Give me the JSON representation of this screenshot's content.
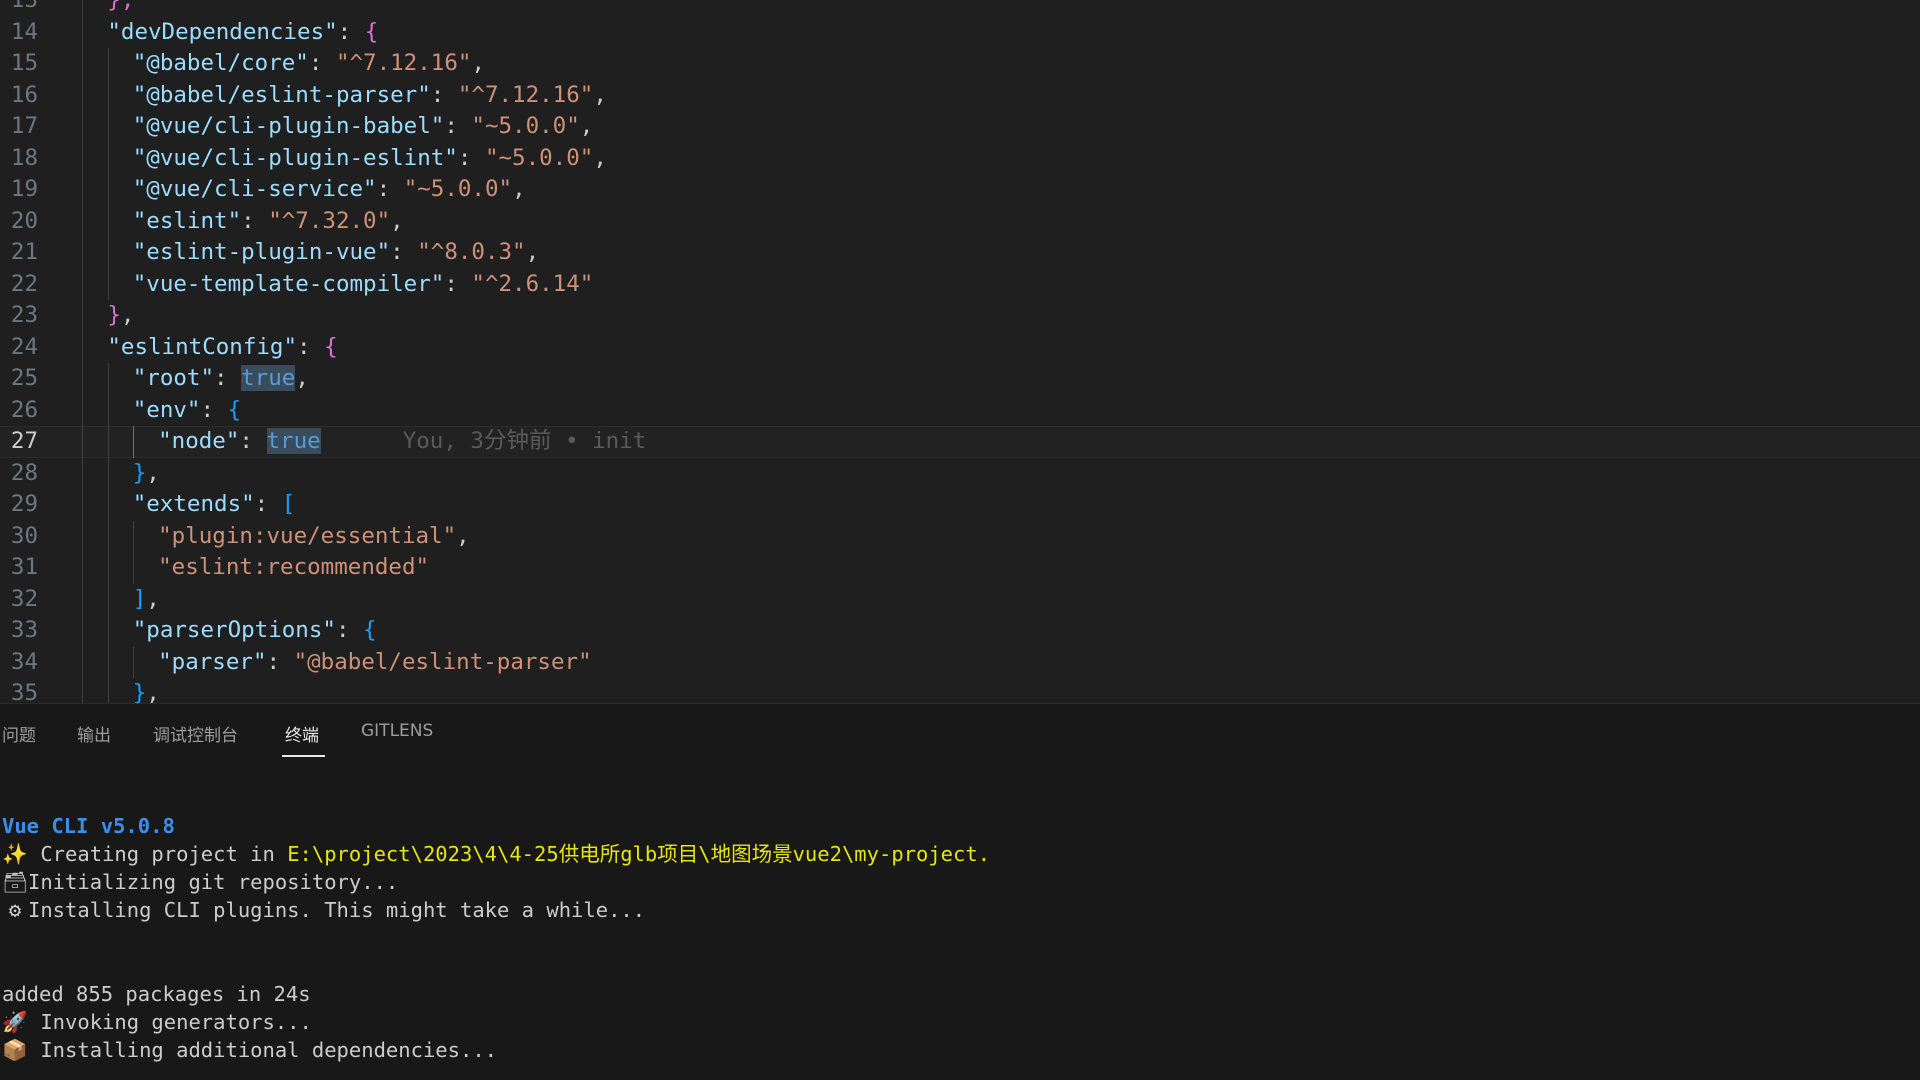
{
  "editor": {
    "lines": [
      {
        "num": "13",
        "frag": [
          {
            "t": "},",
            "c": "b1"
          }
        ]
      },
      {
        "num": "14",
        "frag": [
          {
            "t": "\"devDependencies\"",
            "c": "k"
          },
          {
            "t": ": ",
            "c": "p"
          },
          {
            "t": "{",
            "c": "b1"
          }
        ]
      },
      {
        "num": "15",
        "frag": [
          {
            "t": "\"@babel/core\"",
            "c": "k"
          },
          {
            "t": ": ",
            "c": "p"
          },
          {
            "t": "\"^7.12.16\"",
            "c": "s"
          },
          {
            "t": ",",
            "c": "p"
          }
        ]
      },
      {
        "num": "16",
        "frag": [
          {
            "t": "\"@babel/eslint-parser\"",
            "c": "k"
          },
          {
            "t": ": ",
            "c": "p"
          },
          {
            "t": "\"^7.12.16\"",
            "c": "s"
          },
          {
            "t": ",",
            "c": "p"
          }
        ]
      },
      {
        "num": "17",
        "frag": [
          {
            "t": "\"@vue/cli-plugin-babel\"",
            "c": "k"
          },
          {
            "t": ": ",
            "c": "p"
          },
          {
            "t": "\"~5.0.0\"",
            "c": "s"
          },
          {
            "t": ",",
            "c": "p"
          }
        ]
      },
      {
        "num": "18",
        "frag": [
          {
            "t": "\"@vue/cli-plugin-eslint\"",
            "c": "k"
          },
          {
            "t": ": ",
            "c": "p"
          },
          {
            "t": "\"~5.0.0\"",
            "c": "s"
          },
          {
            "t": ",",
            "c": "p"
          }
        ]
      },
      {
        "num": "19",
        "frag": [
          {
            "t": "\"@vue/cli-service\"",
            "c": "k"
          },
          {
            "t": ": ",
            "c": "p"
          },
          {
            "t": "\"~5.0.0\"",
            "c": "s"
          },
          {
            "t": ",",
            "c": "p"
          }
        ]
      },
      {
        "num": "20",
        "frag": [
          {
            "t": "\"eslint\"",
            "c": "k"
          },
          {
            "t": ": ",
            "c": "p"
          },
          {
            "t": "\"^7.32.0\"",
            "c": "s"
          },
          {
            "t": ",",
            "c": "p"
          }
        ]
      },
      {
        "num": "21",
        "frag": [
          {
            "t": "\"eslint-plugin-vue\"",
            "c": "k"
          },
          {
            "t": ": ",
            "c": "p"
          },
          {
            "t": "\"^8.0.3\"",
            "c": "s"
          },
          {
            "t": ",",
            "c": "p"
          }
        ]
      },
      {
        "num": "22",
        "frag": [
          {
            "t": "\"vue-template-compiler\"",
            "c": "k"
          },
          {
            "t": ": ",
            "c": "p"
          },
          {
            "t": "\"^2.6.14\"",
            "c": "s"
          }
        ]
      },
      {
        "num": "23",
        "frag": [
          {
            "t": "}",
            "c": "b1"
          },
          {
            "t": ",",
            "c": "p"
          }
        ]
      },
      {
        "num": "24",
        "frag": [
          {
            "t": "\"eslintConfig\"",
            "c": "k"
          },
          {
            "t": ": ",
            "c": "p"
          },
          {
            "t": "{",
            "c": "b1"
          }
        ]
      },
      {
        "num": "25",
        "frag": [
          {
            "t": "\"root\"",
            "c": "k"
          },
          {
            "t": ": ",
            "c": "p"
          },
          {
            "t": "true",
            "c": "kw hl"
          },
          {
            "t": ",",
            "c": "p"
          }
        ]
      },
      {
        "num": "26",
        "frag": [
          {
            "t": "\"env\"",
            "c": "k"
          },
          {
            "t": ": ",
            "c": "p"
          },
          {
            "t": "{",
            "c": "b2"
          }
        ]
      },
      {
        "num": "27",
        "frag": [
          {
            "t": "\"node\"",
            "c": "k"
          },
          {
            "t": ": ",
            "c": "p"
          },
          {
            "t": "true",
            "c": "kw hl"
          }
        ]
      },
      {
        "num": "28",
        "frag": [
          {
            "t": "}",
            "c": "b2"
          },
          {
            "t": ",",
            "c": "p"
          }
        ]
      },
      {
        "num": "29",
        "frag": [
          {
            "t": "\"extends\"",
            "c": "k"
          },
          {
            "t": ": ",
            "c": "p"
          },
          {
            "t": "[",
            "c": "b2"
          }
        ]
      },
      {
        "num": "30",
        "frag": [
          {
            "t": "\"plugin:vue/essential\"",
            "c": "s"
          },
          {
            "t": ",",
            "c": "p"
          }
        ]
      },
      {
        "num": "31",
        "frag": [
          {
            "t": "\"eslint:recommended\"",
            "c": "s"
          }
        ]
      },
      {
        "num": "32",
        "frag": [
          {
            "t": "]",
            "c": "b2"
          },
          {
            "t": ",",
            "c": "p"
          }
        ]
      },
      {
        "num": "33",
        "frag": [
          {
            "t": "\"parserOptions\"",
            "c": "k"
          },
          {
            "t": ": ",
            "c": "p"
          },
          {
            "t": "{",
            "c": "b2"
          }
        ]
      },
      {
        "num": "34",
        "frag": [
          {
            "t": "\"parser\"",
            "c": "k"
          },
          {
            "t": ": ",
            "c": "p"
          },
          {
            "t": "\"@babel/eslint-parser\"",
            "c": "s"
          }
        ]
      },
      {
        "num": "35",
        "frag": [
          {
            "t": "}",
            "c": "b2"
          },
          {
            "t": ",",
            "c": "p"
          }
        ]
      }
    ],
    "blame": "You, 3分钟前 • init"
  },
  "panel": {
    "tabs": [
      "问题",
      "输出",
      "调试控制台",
      "终端",
      "GITLENS"
    ],
    "active_tab": "终端"
  },
  "terminal": {
    "version": "Vue CLI v5.0.8",
    "creating_prefix": " Creating project in ",
    "creating_path": "E:\\project\\2023\\4\\4-25供电所glb项目\\地图场景vue2\\my-project",
    "creating_suffix": ".",
    "init_git": "Initializing git repository...",
    "install_plugins": "Installing CLI plugins. This might take a while...",
    "added_packages": "added 855 packages in 24s",
    "invoking": " Invoking generators...",
    "installing_deps": " Installing additional dependencies...",
    "icons": {
      "sparkle": "sparkles-icon",
      "git": "git-icon",
      "gear": "gear-icon",
      "rocket": "rocket-icon",
      "package": "package-icon"
    }
  },
  "colors": {
    "editor_bg": "#1f1f1f",
    "panel_bg": "#181818",
    "json_key": "#9cdcfe",
    "json_string": "#ce9178",
    "json_keyword": "#569cd6",
    "terminal_blue": "#3b8eea",
    "terminal_yellow": "#e5e510"
  }
}
